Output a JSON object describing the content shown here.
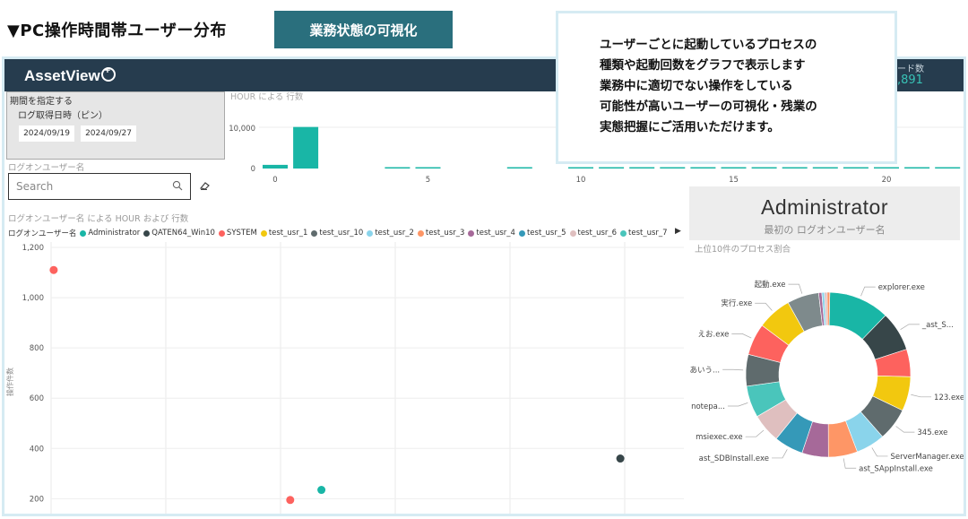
{
  "header": {
    "title": "▼PC操作時間帯ユーザー分布",
    "badge": "業務状態の可視化"
  },
  "callout": {
    "lines": "ユーザーごとに起動しているプロセスの\n種類や起動回数をグラフで表示します\n業務中に適切でない操作をしている\n可能性が高いユーザーの可視化・残業の\n実態把握にご活用いただけます。"
  },
  "app": {
    "logo": "AssetView",
    "kpi_label": "ード数",
    "kpi_value": ",891"
  },
  "period": {
    "title": "期間を指定する",
    "subtitle": "ログ取得日時（ピン）",
    "date_from": "2024/09/19",
    "date_to": "2024/09/27"
  },
  "logon_user_label": "ログオンユーザー名",
  "search": {
    "placeholder": "Search"
  },
  "scatter_title": "ログオンユーザー名 による HOUR および 行数",
  "pie_title": "上位10件のプロセス割合",
  "admin_card": {
    "name": "Administrator",
    "subtitle": "最初の ログオンユーザー名"
  },
  "legend": {
    "label": "ログオンユーザー名",
    "items": [
      {
        "name": "Administrator",
        "color": "#19b6a6"
      },
      {
        "name": "QATEN64_Win10",
        "color": "#374649"
      },
      {
        "name": "SYSTEM",
        "color": "#fd625e"
      },
      {
        "name": "test_usr_1",
        "color": "#f2c80f"
      },
      {
        "name": "test_usr_10",
        "color": "#5f6b6d"
      },
      {
        "name": "test_usr_2",
        "color": "#8ad4eb"
      },
      {
        "name": "test_usr_3",
        "color": "#fe9666"
      },
      {
        "name": "test_usr_4",
        "color": "#a66999"
      },
      {
        "name": "test_usr_5",
        "color": "#3599b8"
      },
      {
        "name": "test_usr_6",
        "color": "#dfbfbf"
      },
      {
        "name": "test_usr_7",
        "color": "#4ac5bb"
      }
    ]
  },
  "chart_data": [
    {
      "type": "bar",
      "title": "HOUR による 行数",
      "x_ticks": [
        "0",
        "5",
        "10",
        "15",
        "20"
      ],
      "y_ticks": [
        "10,000",
        "0"
      ],
      "ylim": [
        0,
        11000
      ],
      "x": [
        0,
        1,
        4,
        5,
        8,
        10,
        11,
        12,
        13,
        14,
        15,
        16,
        17,
        18,
        19,
        20,
        21,
        22
      ],
      "values": [
        900,
        10200,
        150,
        150,
        150,
        150,
        150,
        150,
        150,
        150,
        150,
        150,
        150,
        150,
        150,
        150,
        150,
        150
      ],
      "color": "#19b6a6"
    },
    {
      "type": "scatter",
      "title": "ログオンユーザー名 による HOUR および 行数",
      "ylabel": "操作件数",
      "y_ticks": [
        "1,200",
        "1,000",
        "800",
        "600",
        "400",
        "200"
      ],
      "ylim": [
        130,
        1200
      ],
      "xlim": [
        0,
        24
      ],
      "points": [
        {
          "series": "SYSTEM",
          "x": 0.1,
          "y": 1110,
          "color": "#fd625e"
        },
        {
          "series": "SYSTEM",
          "x": 9.2,
          "y": 195,
          "color": "#fd625e"
        },
        {
          "series": "Administrator",
          "x": 10.4,
          "y": 235,
          "color": "#19b6a6"
        },
        {
          "series": "QATEN64_Win10",
          "x": 21.9,
          "y": 360,
          "color": "#374649"
        }
      ]
    },
    {
      "type": "pie",
      "title": "上位10件のプロセス割合",
      "slices": [
        {
          "label": "explorer.exe",
          "value": 11.5,
          "color": "#19b6a6"
        },
        {
          "label": "_ast_S...",
          "value": 7.5,
          "color": "#374649"
        },
        {
          "label": "",
          "value": 5.2,
          "color": "#fd625e"
        },
        {
          "label": "123.exe",
          "value": 6.5,
          "color": "#f2c80f"
        },
        {
          "label": "345.exe",
          "value": 6.2,
          "color": "#5f6b6d"
        },
        {
          "label": "ServerManager.exe",
          "value": 5.5,
          "color": "#8ad4eb"
        },
        {
          "label": "ast_SAppInstall.exe",
          "value": 5.5,
          "color": "#fe9666"
        },
        {
          "label": "",
          "value": 5.0,
          "color": "#a66999"
        },
        {
          "label": "ast_SDBInstall.exe",
          "value": 5.5,
          "color": "#3599b8"
        },
        {
          "label": "msiexec.exe",
          "value": 5.5,
          "color": "#dfbfbf"
        },
        {
          "label": "notepa...",
          "value": 6.0,
          "color": "#4ac5bb"
        },
        {
          "label": "あいう...",
          "value": 6.0,
          "color": "#5f6b6d"
        },
        {
          "label": "えお.exe",
          "value": 6.0,
          "color": "#fd625e"
        },
        {
          "label": "実行.exe",
          "value": 6.5,
          "color": "#f2c80f"
        },
        {
          "label": "起動.exe",
          "value": 6.0,
          "color": "#7e8a8c"
        },
        {
          "label": "",
          "value": 0.6,
          "color": "#a66999"
        },
        {
          "label": "",
          "value": 0.5,
          "color": "#8ad4eb"
        },
        {
          "label": "",
          "value": 0.5,
          "color": "#dfbfbf"
        },
        {
          "label": "",
          "value": 0.5,
          "color": "#fe9666"
        }
      ]
    }
  ]
}
